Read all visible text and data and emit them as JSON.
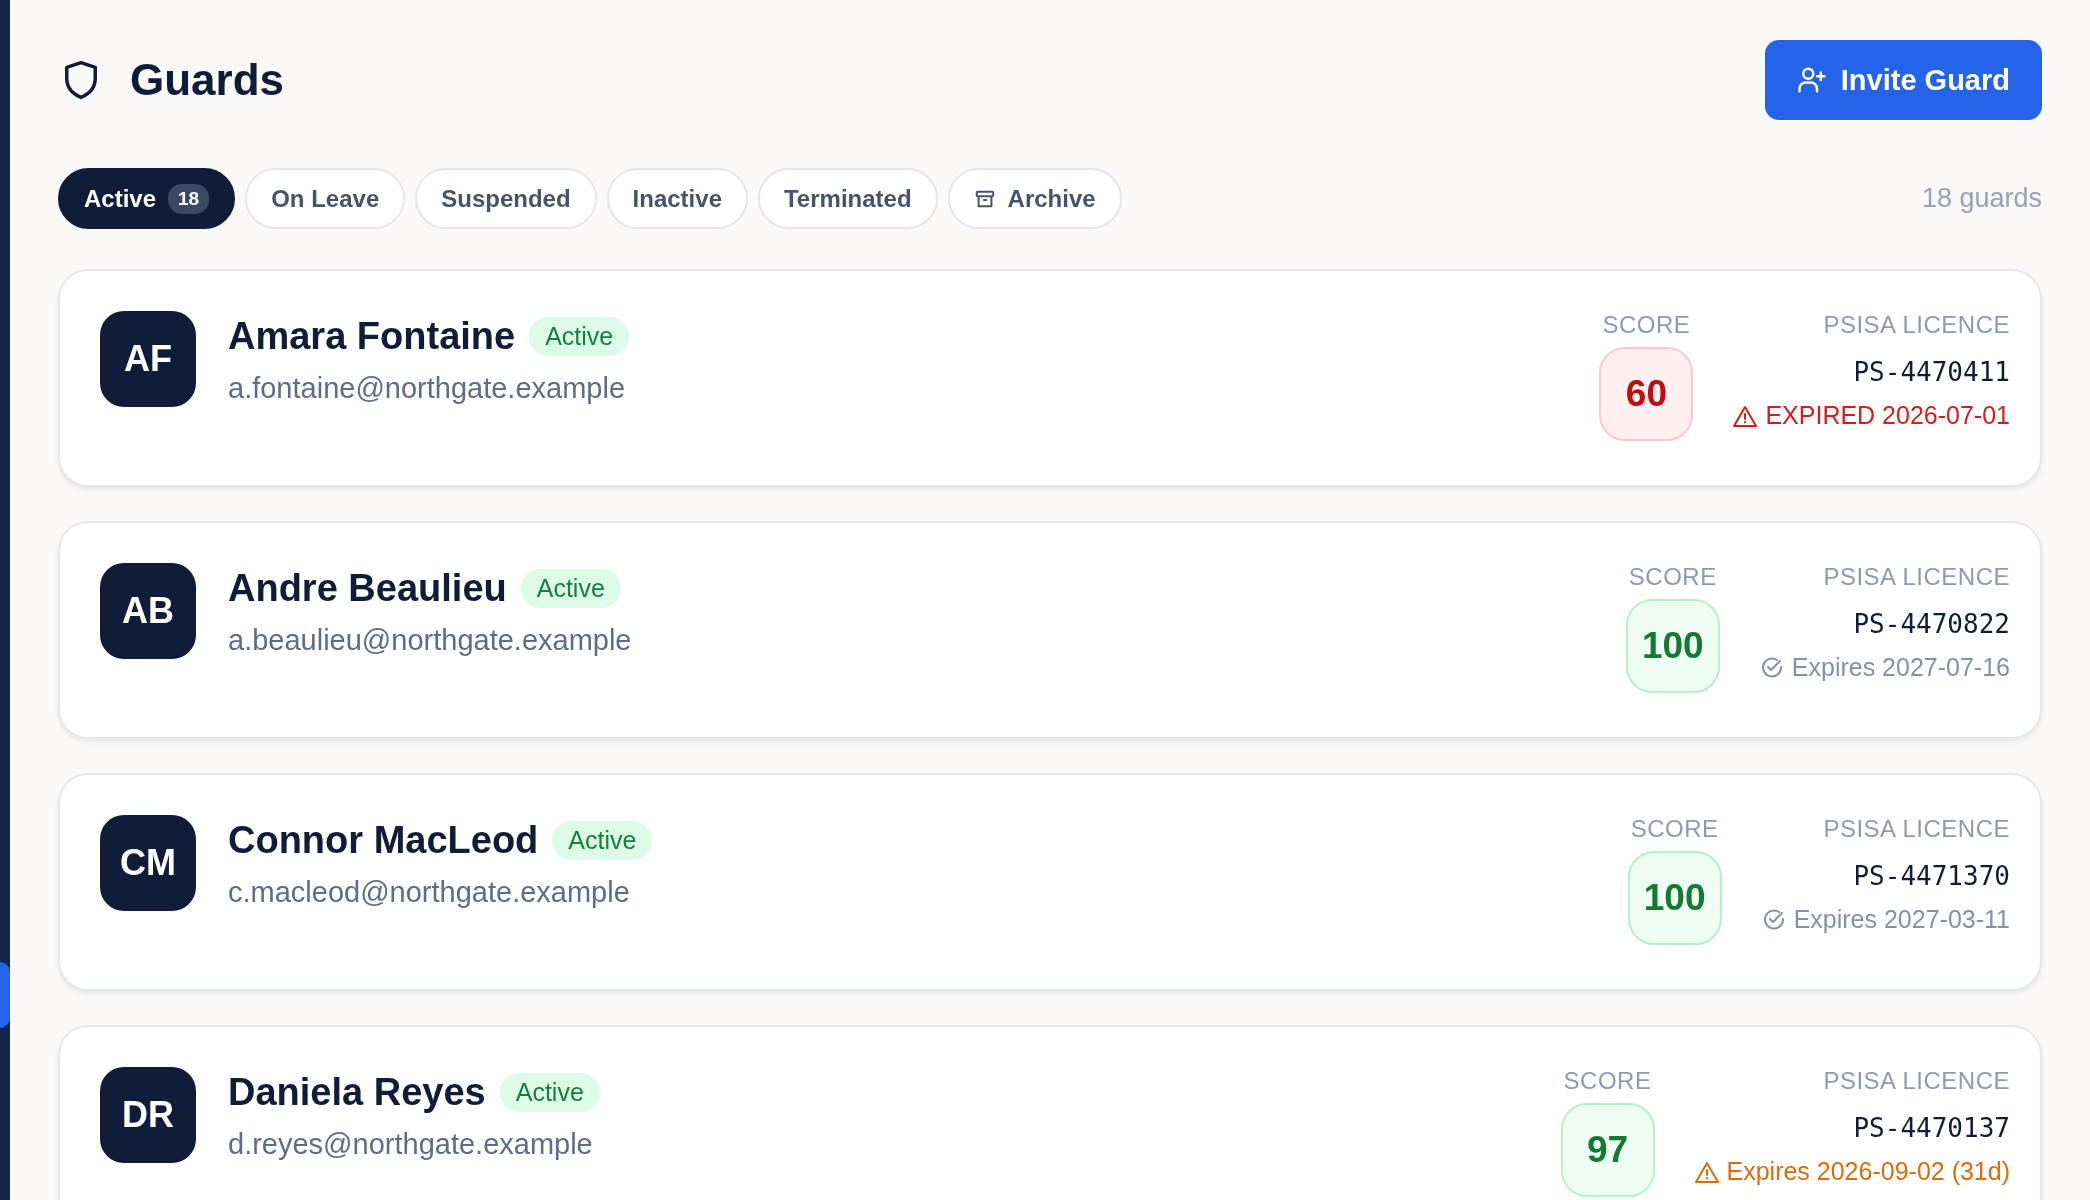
{
  "header": {
    "title": "Guards",
    "invite_button": "Invite Guard"
  },
  "tabs": [
    {
      "label": "Active",
      "count": "18",
      "selected": true,
      "kind": "plain"
    },
    {
      "label": "On Leave",
      "selected": false,
      "kind": "plain"
    },
    {
      "label": "Suspended",
      "selected": false,
      "kind": "plain"
    },
    {
      "label": "Inactive",
      "selected": false,
      "kind": "plain"
    },
    {
      "label": "Terminated",
      "selected": false,
      "kind": "plain"
    },
    {
      "label": "Archive",
      "selected": false,
      "kind": "archive"
    }
  ],
  "guard_count": "18 guards",
  "guards": [
    {
      "initials": "AF",
      "name": "Amara Fontaine",
      "status": "Active",
      "email": "a.fontaine@northgate.example",
      "score": {
        "label": "SCORE",
        "value": "60",
        "kind": "low"
      },
      "licence": {
        "label": "PSISA LICENCE",
        "number": "PS-4470411",
        "note": "EXPIRED 2026-07-01",
        "kind": "expired"
      }
    },
    {
      "initials": "AB",
      "name": "Andre Beaulieu",
      "status": "Active",
      "email": "a.beaulieu@northgate.example",
      "score": {
        "label": "SCORE",
        "value": "100",
        "kind": "good"
      },
      "licence": {
        "label": "PSISA LICENCE",
        "number": "PS-4470822",
        "note": "Expires 2027-07-16",
        "kind": "valid"
      }
    },
    {
      "initials": "CM",
      "name": "Connor MacLeod",
      "status": "Active",
      "email": "c.macleod@northgate.example",
      "score": {
        "label": "SCORE",
        "value": "100",
        "kind": "good"
      },
      "licence": {
        "label": "PSISA LICENCE",
        "number": "PS-4471370",
        "note": "Expires 2027-03-11",
        "kind": "valid"
      }
    },
    {
      "initials": "DR",
      "name": "Daniela Reyes",
      "status": "Active",
      "email": "d.reyes@northgate.example",
      "score": {
        "label": "SCORE",
        "value": "97",
        "kind": "good"
      },
      "licence": {
        "label": "PSISA LICENCE",
        "number": "PS-4470137",
        "note": "Expires 2026-09-02 (31d)",
        "kind": "expiring"
      }
    }
  ]
}
